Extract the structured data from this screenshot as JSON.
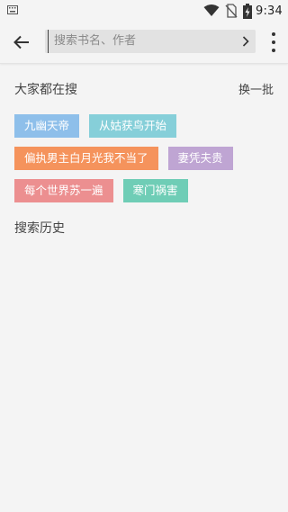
{
  "status_bar": {
    "time": "9:34",
    "icons": [
      "keyboard-icon",
      "wifi-icon",
      "no-sim-icon",
      "battery-charging-icon"
    ]
  },
  "toolbar": {
    "back_icon": "arrow-left-icon",
    "search": {
      "value": "",
      "placeholder": "搜索书名、作者"
    },
    "go_icon": "chevron-right-icon",
    "more_icon": "more-vert-icon"
  },
  "hot_search": {
    "title": "大家都在搜",
    "refresh_label": "换一批",
    "tags": [
      {
        "label": "九幽天帝",
        "color": "#8ebfea"
      },
      {
        "label": "从姑获鸟开始",
        "color": "#86cfd9"
      },
      {
        "label": "偏执男主白月光我不当了",
        "color": "#f5935c"
      },
      {
        "label": "妻凭夫贵",
        "color": "#bfa5d3"
      },
      {
        "label": "每个世界苏一遍",
        "color": "#ec8f90"
      },
      {
        "label": "寒门祸害",
        "color": "#6fcdb6"
      }
    ]
  },
  "history": {
    "title": "搜索历史",
    "items": []
  }
}
